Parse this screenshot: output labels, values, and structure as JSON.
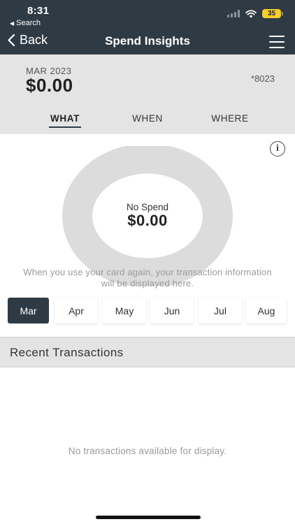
{
  "status_bar": {
    "time": "8:31",
    "back_app": "Search",
    "battery": "35"
  },
  "nav": {
    "back_label": "Back",
    "title": "Spend Insights"
  },
  "summary": {
    "period": "MAR 2023",
    "total": "$0.00",
    "card_number": "*8023"
  },
  "tabs": [
    {
      "label": "WHAT",
      "active": true
    },
    {
      "label": "WHEN",
      "active": false
    },
    {
      "label": "WHERE",
      "active": false
    }
  ],
  "donut": {
    "label": "No Spend",
    "value": "$0.00",
    "empty_message": "When you use your card again, your transaction information will be displayed here."
  },
  "months": [
    {
      "label": "Mar",
      "active": true
    },
    {
      "label": "Apr",
      "active": false
    },
    {
      "label": "May",
      "active": false
    },
    {
      "label": "Jun",
      "active": false
    },
    {
      "label": "Jul",
      "active": false
    },
    {
      "label": "Aug",
      "active": false
    }
  ],
  "recent": {
    "title": "Recent Transactions",
    "empty_message": "No transactions available for display."
  },
  "colors": {
    "header_bg": "#2f3b44",
    "panel_bg": "#e4e4e4",
    "donut_ring": "#dcdcdc",
    "battery": "#f5cd2d"
  },
  "icons": {
    "back": "chevron-left-icon",
    "menu": "hamburger-menu-icon",
    "info": "info-icon",
    "wifi": "wifi-icon",
    "signal": "cellular-signal-icon",
    "battery": "battery-icon"
  }
}
